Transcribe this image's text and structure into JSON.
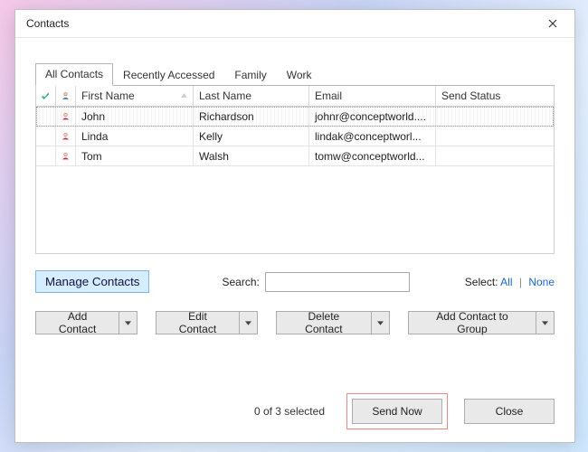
{
  "window": {
    "title": "Contacts"
  },
  "tabs": [
    {
      "label": "All Contacts",
      "active": true
    },
    {
      "label": "Recently Accessed",
      "active": false
    },
    {
      "label": "Family",
      "active": false
    },
    {
      "label": "Work",
      "active": false
    }
  ],
  "columns": {
    "first_name": "First Name",
    "last_name": "Last Name",
    "email": "Email",
    "send_status": "Send Status"
  },
  "rows": [
    {
      "first": "John",
      "last": "Richardson",
      "email": "johnr@conceptworld....",
      "selected": true
    },
    {
      "first": "Linda",
      "last": "Kelly",
      "email": "lindak@conceptworl...",
      "selected": false
    },
    {
      "first": "Tom",
      "last": "Walsh",
      "email": "tomw@conceptworld...",
      "selected": false
    }
  ],
  "manage_contacts": "Manage Contacts",
  "search_label": "Search:",
  "search_value": "",
  "select_label": "Select:",
  "select_all": "All",
  "select_none": "None",
  "buttons": {
    "add_contact": "Add Contact",
    "edit_contact": "Edit Contact",
    "delete_contact": "Delete Contact",
    "add_to_group": "Add Contact to Group"
  },
  "status_text": "0 of 3 selected",
  "send_now": "Send Now",
  "close": "Close"
}
